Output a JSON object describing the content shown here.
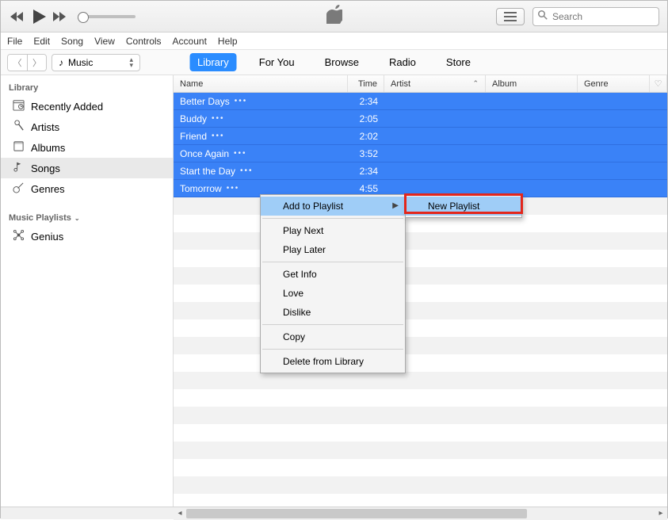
{
  "window_controls": {
    "min": "—",
    "max": "☐",
    "close": "✕"
  },
  "search": {
    "placeholder": "Search"
  },
  "menubar": [
    "File",
    "Edit",
    "Song",
    "View",
    "Controls",
    "Account",
    "Help"
  ],
  "nav": {
    "source": {
      "label": "Music",
      "icon": "music-note"
    },
    "tabs": [
      {
        "label": "Library",
        "active": true
      },
      {
        "label": "For You",
        "active": false
      },
      {
        "label": "Browse",
        "active": false
      },
      {
        "label": "Radio",
        "active": false
      },
      {
        "label": "Store",
        "active": false
      }
    ]
  },
  "sidebar": {
    "library_header": "Library",
    "items": [
      {
        "icon": "recent",
        "label": "Recently Added"
      },
      {
        "icon": "mic",
        "label": "Artists"
      },
      {
        "icon": "album",
        "label": "Albums"
      },
      {
        "icon": "song",
        "label": "Songs",
        "selected": true
      },
      {
        "icon": "genre",
        "label": "Genres"
      }
    ],
    "playlists_header": "Music Playlists",
    "playlists": [
      {
        "icon": "genius",
        "label": "Genius"
      }
    ]
  },
  "columns": {
    "name": "Name",
    "time": "Time",
    "artist": "Artist",
    "album": "Album",
    "genre": "Genre"
  },
  "songs": [
    {
      "name": "Better Days",
      "time": "2:34"
    },
    {
      "name": "Buddy",
      "time": "2:05"
    },
    {
      "name": "Friend",
      "time": "2:02"
    },
    {
      "name": "Once Again",
      "time": "3:52"
    },
    {
      "name": "Start the Day",
      "time": "2:34"
    },
    {
      "name": "Tomorrow",
      "time": "4:55"
    }
  ],
  "context_menu": {
    "add_to_playlist": "Add to Playlist",
    "play_next": "Play Next",
    "play_later": "Play Later",
    "get_info": "Get Info",
    "love": "Love",
    "dislike": "Dislike",
    "copy": "Copy",
    "delete": "Delete from Library"
  },
  "submenu": {
    "new_playlist": "New Playlist"
  }
}
